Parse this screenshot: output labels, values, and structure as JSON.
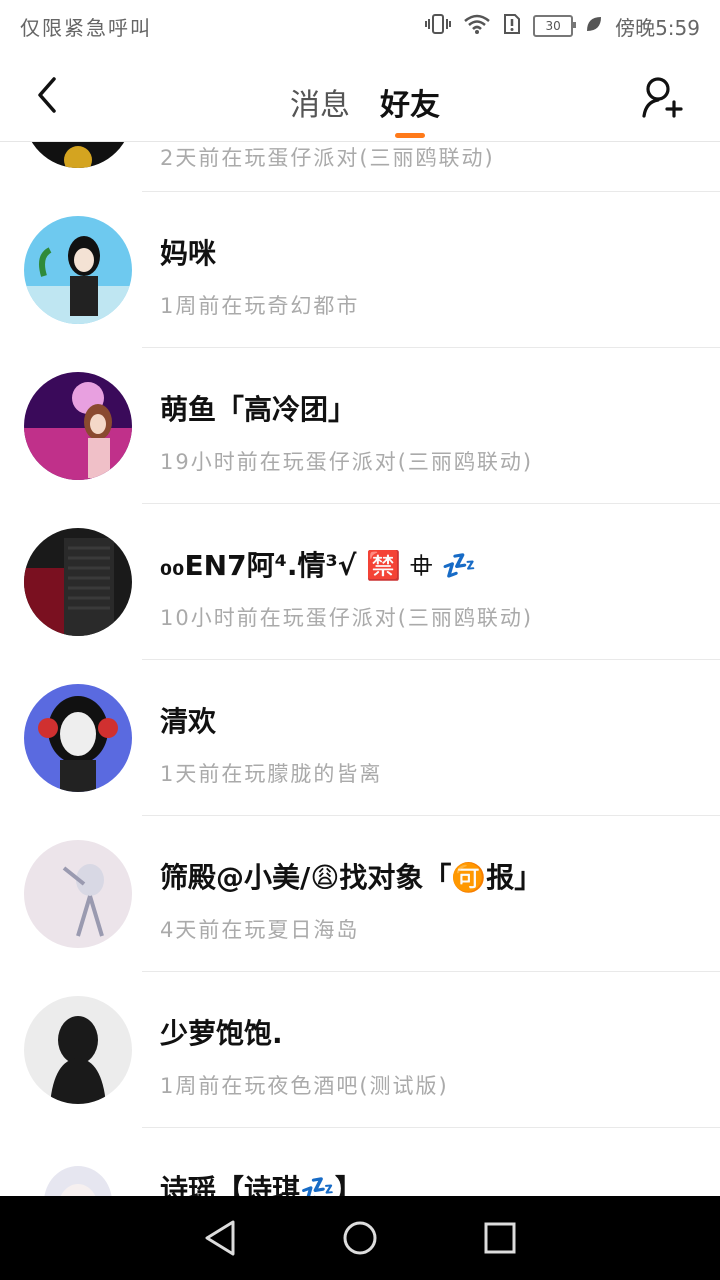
{
  "status_bar": {
    "left_text": "仅限紧急呼叫",
    "battery": "30",
    "time_text": "傍晚5:59"
  },
  "header": {
    "tabs": [
      {
        "label": "消息",
        "active": false
      },
      {
        "label": "好友",
        "active": true
      }
    ],
    "accent_color": "#ff7a1a"
  },
  "friends": [
    {
      "name": "",
      "status": "2天前在玩蛋仔派对(三丽鸥联动)",
      "avatar_colors": [
        "#111111",
        "#3a3a3a"
      ]
    },
    {
      "name": "妈咪",
      "status": "1周前在玩奇幻都市",
      "avatar_colors": [
        "#6ec9ef",
        "#f2f2f2"
      ]
    },
    {
      "name": "萌鱼「高冷团」",
      "status": "19小时前在玩蛋仔派对(三丽鸥联动)",
      "avatar_colors": [
        "#5a1a7a",
        "#e0609a"
      ]
    },
    {
      "name": "₀₀EN7阿⁴.情³√ 🈲 ⯐ 💤",
      "status": "10小时前在玩蛋仔派对(三丽鸥联动)",
      "avatar_colors": [
        "#1a1a1a",
        "#7a1020"
      ]
    },
    {
      "name": "清欢",
      "status": "1天前在玩朦胧的皆离",
      "avatar_colors": [
        "#4a5ad8",
        "#d8d8f0"
      ]
    },
    {
      "name": "筛殿@小美/😩找对象「🉑报」",
      "status": "4天前在玩夏日海岛",
      "avatar_colors": [
        "#ece4ea",
        "#bcbcc8"
      ]
    },
    {
      "name": "少萝饱饱.",
      "status": "1周前在玩夜色酒吧(测试版)",
      "avatar_colors": [
        "#ececec",
        "#222222"
      ]
    },
    {
      "name": "诗瑶【诗琪💤】",
      "status": "",
      "avatar_colors": [
        "#ffffff",
        "#d6d6e6"
      ]
    }
  ]
}
